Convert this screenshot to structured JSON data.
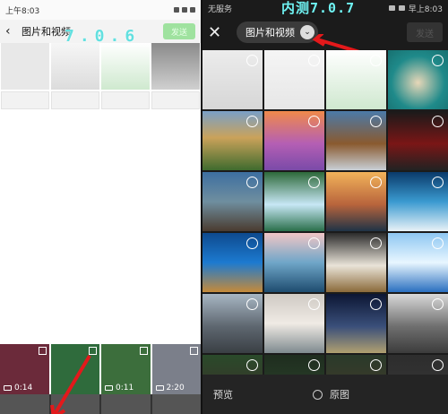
{
  "left": {
    "status_time": "上午8:03",
    "nav_title": "图片和视频",
    "send_label": "发送",
    "watermark": "7.0.6",
    "videos": [
      {
        "duration": "0:14",
        "bg": "#6b2a3a"
      },
      {
        "duration": "",
        "bg": "#2f6b3c"
      },
      {
        "duration": "0:11",
        "bg": "#3c6e3c"
      },
      {
        "duration": "2:20",
        "bg": "#7b7f8a"
      }
    ]
  },
  "right": {
    "status_left": "无服务",
    "status_time": "早上8:03",
    "watermark": "内测7.0.7",
    "album_label": "图片和视频",
    "send_label": "发送",
    "preview_label": "预览",
    "original_label": "原图",
    "tiles": [
      {
        "bg": "linear-gradient(#ececec,#d6d6d6)"
      },
      {
        "bg": "linear-gradient(#f5f5f5,#e6e6e6)"
      },
      {
        "bg": "linear-gradient(#fff,#cfe8cf)"
      },
      {
        "bg": "radial-gradient(circle at 50% 55%,#e7d7b8 0,#1f8a8a 60%,#177070 100%)"
      },
      {
        "bg": "linear-gradient(#7aa0c7 0,#caa25a 45%,#3f6b2e 100%)"
      },
      {
        "bg": "linear-gradient(#f08a4b,#b45fb4 55%,#7a4aa8)"
      },
      {
        "bg": "linear-gradient(#4b7aa9,#8a5a2f 55%,#c8cfd6)"
      },
      {
        "bg": "linear-gradient(#1a1a1a,#7a1616 55%,#222)"
      },
      {
        "bg": "linear-gradient(#3d6fa0,#6f8e9f 50%,#4a3b2f)"
      },
      {
        "bg": "linear-gradient(#2e6a3a,#c7e7f5 55%,#2a6f4a)"
      },
      {
        "bg": "linear-gradient(#f2b35a,#b8643c 55%,#1f3346)"
      },
      {
        "bg": "linear-gradient(#0a3a6a,#3a9ad0 50%,#e9f2f7)"
      },
      {
        "bg": "linear-gradient(#0e4a8e,#1c7ad0 50%,#c58a3a)"
      },
      {
        "bg": "linear-gradient(#f1c6c6,#6fa6c8 50%,#1e4c6f)"
      },
      {
        "bg": "linear-gradient(#2b2b2b,#e9e3d8 55%,#8a6a3a)"
      },
      {
        "bg": "linear-gradient(#8ec7f2,#e8f6ff 50%,#2a6fbf)"
      },
      {
        "bg": "linear-gradient(#a7b6c3,#5e6770 55%,#3a3f44)"
      },
      {
        "bg": "linear-gradient(#cfcac3,#efeae4 50%,#7f8a8f)"
      },
      {
        "bg": "linear-gradient(#0c1633,#3a4f7a 55%,#b0a070)"
      },
      {
        "bg": "linear-gradient(#d9d9d9,#6f6f6f 55%,#3c3c3c)"
      },
      {
        "bg": "linear-gradient(#2a4a2a,#3f2a2a)"
      },
      {
        "bg": "linear-gradient(#1f2d1f,#2e4a2e)"
      },
      {
        "bg": "linear-gradient(#2a3a2a,#4a3a2a)"
      },
      {
        "bg": "linear-gradient(#2d2d2d,#3a3a3a)"
      }
    ]
  }
}
